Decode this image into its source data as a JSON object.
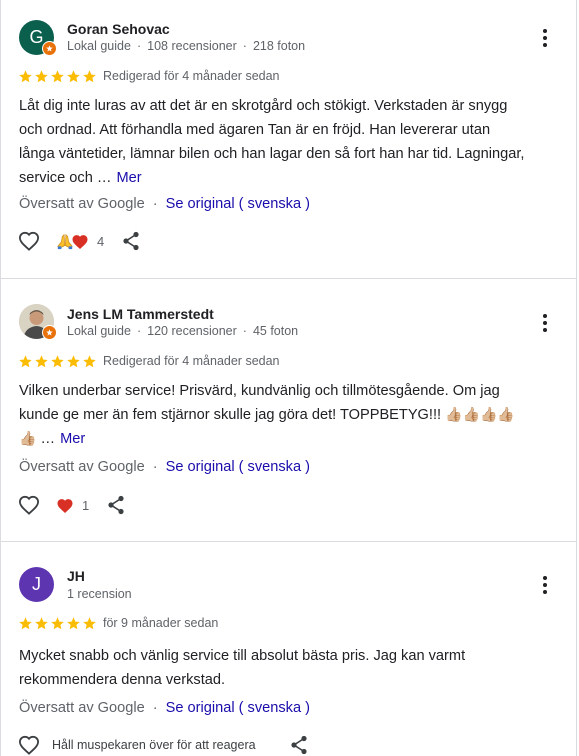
{
  "reviews": [
    {
      "name": "Goran Sehovac",
      "avatar_letter": "G",
      "avatar_color": "#0b5f4d",
      "meta": {
        "guide": "Lokal guide",
        "reviews": "108 recensioner",
        "photos": "218 foton"
      },
      "rating": 5,
      "date": "Redigerad för 4 månader sedan",
      "text_lines": [
        "Låt dig inte luras av att det är en skrotgård och stökigt. Verkstaden är snygg",
        "och ordnad. Att förhandla med ägaren Tan är en fröjd. Han levererar utan",
        "långa väntetider, lämnar bilen och han lagar den så fort han har tid. Lagningar,",
        "service och …"
      ],
      "more": "Mer",
      "translated_by": "Översatt av Google",
      "original_link": "Se original ( svenska )",
      "reaction_count": "4"
    },
    {
      "name": "Jens LM Tammerstedt",
      "meta": {
        "guide": "Lokal guide",
        "reviews": "120 recensioner",
        "photos": "45 foton"
      },
      "rating": 5,
      "date": "Redigerad för 4 månader sedan",
      "text_lines": [
        "Vilken underbar service! Prisvärd, kundvänlig och tillmötesgående. Om jag",
        "kunde ge mer än fem stjärnor skulle jag göra det! TOPPBETYG!!!"
      ],
      "thumbs_line2": "👍🏼👍🏼👍🏼👍🏼",
      "thumbs_line3": "👍🏼",
      "ellipsis": "…",
      "more": "Mer",
      "translated_by": "Översatt av Google",
      "original_link": "Se original ( svenska )",
      "reaction_count": "1"
    },
    {
      "name": "JH",
      "avatar_letter": "J",
      "avatar_color": "#5e35b1",
      "meta": {
        "reviews": "1 recension"
      },
      "rating": 5,
      "date": "för 9 månader sedan",
      "text_lines": [
        "Mycket snabb och vänlig service till absolut bästa pris. Jag kan varmt",
        "rekommendera denna verkstad."
      ],
      "translated_by": "Översatt av Google",
      "original_link": "Se original ( svenska )",
      "hover_hint": "Håll muspekaren över för att reagera"
    }
  ],
  "colors": {
    "star": "#fbbc04",
    "link": "#1a0dab",
    "heart": "#d93025",
    "badge": "#e8710a"
  }
}
